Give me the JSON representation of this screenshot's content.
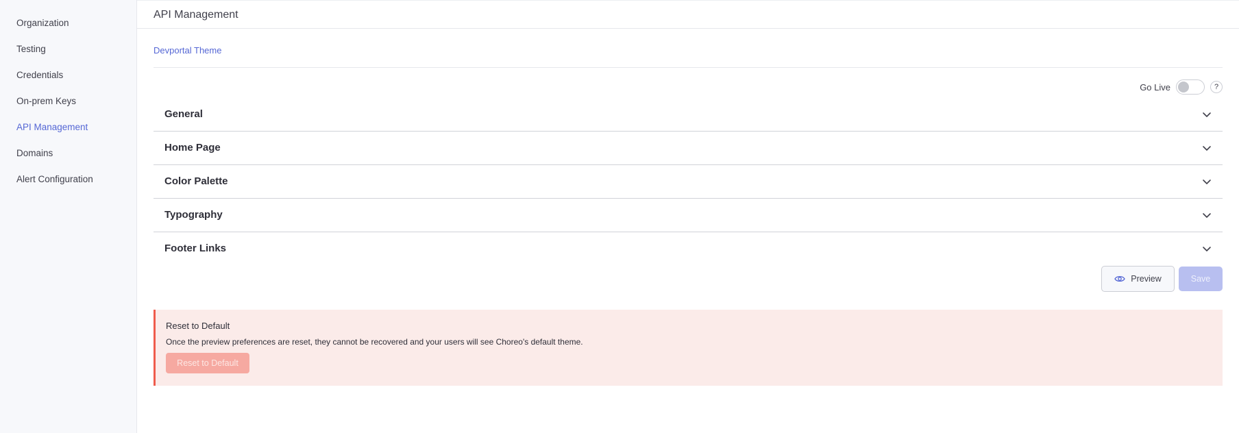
{
  "sidebar": {
    "items": [
      {
        "label": "Organization"
      },
      {
        "label": "Testing"
      },
      {
        "label": "Credentials"
      },
      {
        "label": "On-prem Keys"
      },
      {
        "label": "API Management",
        "active": true
      },
      {
        "label": "Domains"
      },
      {
        "label": "Alert Configuration"
      }
    ]
  },
  "header": {
    "title": "API Management"
  },
  "tabs": {
    "active_label": "Devportal Theme"
  },
  "go_live": {
    "label": "Go Live",
    "enabled": false,
    "help_icon": "?"
  },
  "accordion": {
    "sections": [
      {
        "title": "General"
      },
      {
        "title": "Home Page"
      },
      {
        "title": "Color Palette"
      },
      {
        "title": "Typography"
      },
      {
        "title": "Footer Links"
      }
    ]
  },
  "actions": {
    "preview_label": "Preview",
    "save_label": "Save"
  },
  "reset": {
    "title": "Reset to Default",
    "description": "Once the preview preferences are reset, they cannot be recovered and your users will see Choreo's default theme.",
    "button_label": "Reset to Default"
  },
  "colors": {
    "accent": "#5567d5",
    "danger": "#ef5b4c",
    "danger_bg": "#fbebe9",
    "sidebar_bg": "#f7f8fb"
  }
}
